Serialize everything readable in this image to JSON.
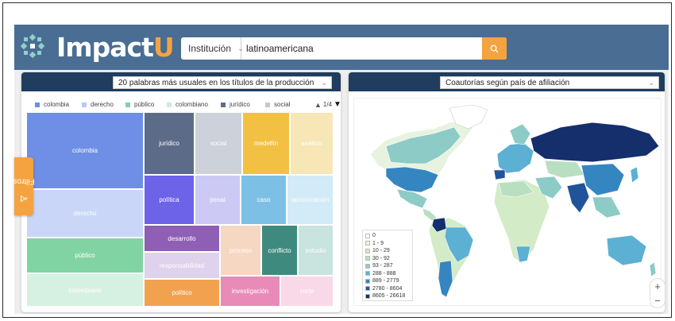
{
  "header": {
    "brand_main": "Impact",
    "brand_accent": "U",
    "search_scope": "Institución",
    "search_value": "latinoamericana"
  },
  "left_panel": {
    "selector": "20 palabras más usuales en los títulos de la producción",
    "legend": [
      {
        "label": "colombia",
        "color": "#6f8fe6"
      },
      {
        "label": "derecho",
        "color": "#b9c8f4"
      },
      {
        "label": "público",
        "color": "#82d3a3"
      },
      {
        "label": "colombiano",
        "color": "#c9ecd9"
      },
      {
        "label": "jurídico",
        "color": "#5c6b88"
      },
      {
        "label": "social",
        "color": "#c2c7d1"
      }
    ],
    "pager": "1/4",
    "filtros": "Filtros",
    "tiles": [
      {
        "label": "colombia",
        "color": "#6f8fe6"
      },
      {
        "label": "derecho",
        "color": "#c9d6f8"
      },
      {
        "label": "público",
        "color": "#82d3a3"
      },
      {
        "label": "colombiano",
        "color": "#d6f1e1"
      },
      {
        "label": "jurídico",
        "color": "#5c6b88"
      },
      {
        "label": "social",
        "color": "#cdd1d9"
      },
      {
        "label": "medellín",
        "color": "#f2c043"
      },
      {
        "label": "análisis",
        "color": "#f7e6b6"
      },
      {
        "label": "política",
        "color": "#6d63e8"
      },
      {
        "label": "penal",
        "color": "#cccaf5"
      },
      {
        "label": "caso",
        "color": "#7cc0e6"
      },
      {
        "label": "aproximación",
        "color": "#d2ebf7"
      },
      {
        "label": "desarrollo",
        "color": "#8e5fb5"
      },
      {
        "label": "responsabilidad",
        "color": "#dfd2ec"
      },
      {
        "label": "proceso",
        "color": "#f6d7c2"
      },
      {
        "label": "conflicto",
        "color": "#3f8a7e"
      },
      {
        "label": "estudio",
        "color": "#c9e3df"
      },
      {
        "label": "político",
        "color": "#f2a24e"
      },
      {
        "label": "investigación",
        "color": "#e88bb8"
      },
      {
        "label": "corte",
        "color": "#f9d8e7"
      }
    ]
  },
  "right_panel": {
    "selector": "Coautorías según país de afiliación",
    "legend": [
      {
        "label": "0",
        "color": "#ffffff"
      },
      {
        "label": "1 - 9",
        "color": "#e7f3df"
      },
      {
        "label": "10 - 29",
        "color": "#d3ebc6"
      },
      {
        "label": "30 - 92",
        "color": "#b9dfc1"
      },
      {
        "label": "93 - 287",
        "color": "#8ccbc6"
      },
      {
        "label": "288 - 888",
        "color": "#5bb0d3"
      },
      {
        "label": "889 - 2779",
        "color": "#3585c1"
      },
      {
        "label": "2780 - 8604",
        "color": "#20539a"
      },
      {
        "label": "8605 - 26618",
        "color": "#152e6c"
      }
    ],
    "zoom_in": "+",
    "zoom_out": "−"
  }
}
